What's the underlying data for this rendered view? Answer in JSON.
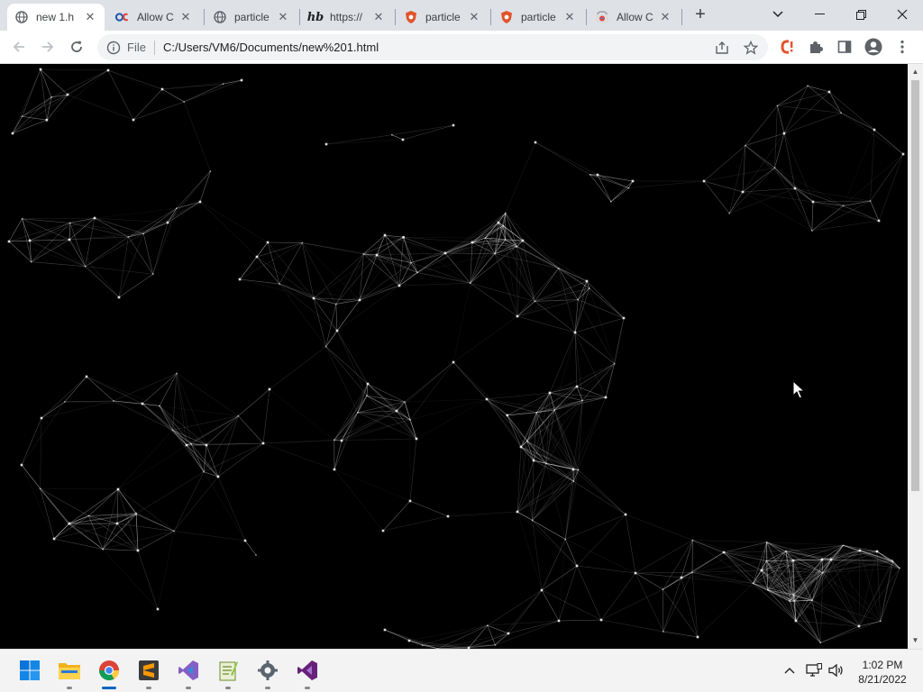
{
  "browser": {
    "tabs": [
      {
        "title": "new 1.h",
        "active": true,
        "favicon": "globe-icon"
      },
      {
        "title": "Allow C",
        "active": false,
        "favicon": "ods-icon"
      },
      {
        "title": "particle",
        "active": false,
        "favicon": "globe-icon"
      },
      {
        "title": "https://",
        "active": false,
        "favicon": "hb-icon"
      },
      {
        "title": "particle",
        "active": false,
        "favicon": "shield-icon"
      },
      {
        "title": "particle",
        "active": false,
        "favicon": "shield-icon"
      },
      {
        "title": "Allow C",
        "active": false,
        "favicon": "chrome-store-icon"
      }
    ],
    "omnibox": {
      "scheme_label": "File",
      "url": "C:/Users/VM6/Documents/new%201.html"
    }
  },
  "taskbar": {
    "apps": [
      "start-icon",
      "file-explorer-icon",
      "chrome-icon",
      "sublime-icon",
      "visual-studio-purple-icon",
      "notepad-plus-icon",
      "settings-icon",
      "visual-studio-icon"
    ],
    "clock": {
      "time": "1:02 PM",
      "date": "8/21/2022"
    }
  },
  "colors": {
    "page_bg": "#000000",
    "particle": "#ffffff",
    "tabstrip": "#dee1e6",
    "accent": "#1a73e8"
  },
  "canvas": {
    "content": "particles.js network animation"
  }
}
